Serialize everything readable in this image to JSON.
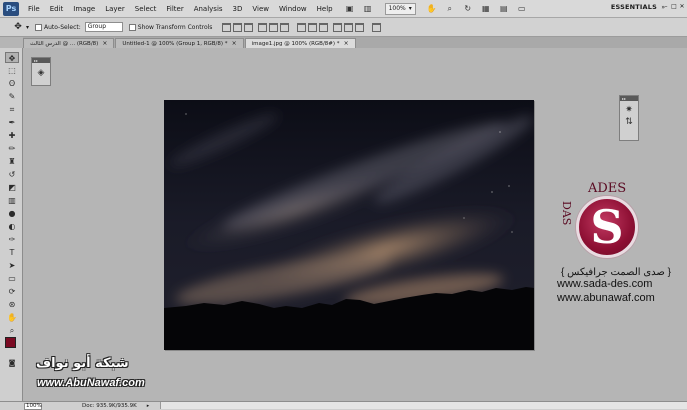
{
  "menubar": {
    "app_logo": "Ps",
    "items": [
      "File",
      "Edit",
      "Image",
      "Layer",
      "Select",
      "Filter",
      "Analysis",
      "3D",
      "View",
      "Window",
      "Help"
    ],
    "zoom": "100%",
    "workspace": "ESSENTIALS"
  },
  "options": {
    "auto_select_label": "Auto-Select:",
    "auto_select_value": "Group",
    "show_transform_label": "Show Transform Controls"
  },
  "tabs": [
    {
      "label": "الدرس الثالث @ ... (RGB/8)",
      "active": false
    },
    {
      "label": "Untitled-1 @ 100% (Group 1, RGB/8) *",
      "active": false
    },
    {
      "label": "image1.jpg @ 100% (RGB/8#) *",
      "active": true
    }
  ],
  "tools": [
    "move-tool",
    "marquee-tool",
    "lasso-tool",
    "quick-selection-tool",
    "crop-tool",
    "eyedropper-tool",
    "healing-brush-tool",
    "brush-tool",
    "clone-stamp-tool",
    "history-brush-tool",
    "eraser-tool",
    "gradient-tool",
    "blur-tool",
    "dodge-tool",
    "pen-tool",
    "type-tool",
    "path-selection-tool",
    "shape-tool",
    "3d-rotate-tool",
    "3d-orbit-tool",
    "hand-tool",
    "zoom-tool"
  ],
  "colors": {
    "foreground": "#7a0a22",
    "background": "#ffffff"
  },
  "watermark": {
    "logo_letter": "S",
    "deco_text": "ADES",
    "deco_side": "DAS",
    "arabic_line": "{ صدى الصمت جرافيكس }",
    "url1": "www.sada-des.com",
    "url2": "www.abunawaf.com",
    "arabic_big": "شبكة أبو نواف",
    "url_big": "www.AbuNawaf.com"
  },
  "status": {
    "zoom": "100%",
    "doc": "Doc: 935.9K/935.9K"
  }
}
